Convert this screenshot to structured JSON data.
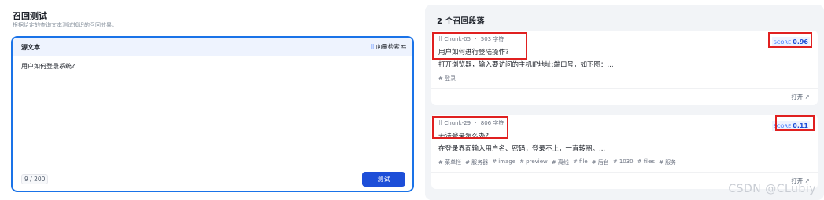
{
  "left": {
    "title": "召回测试",
    "desc": "根据给定的查询文本测试知识的召回效果。",
    "source": {
      "label": "源文本",
      "mode_label": "向量检索",
      "mode_icon": "grid-icon",
      "switch_icon": "swap-icon",
      "text": "用户如何登录系统?",
      "counter": "9 / 200",
      "test_button": "测试"
    }
  },
  "results": {
    "title": "2 个召回段落",
    "items": [
      {
        "chunk": "Chunk-05",
        "chars": "503 字符",
        "question": "用户如何进行登陆操作?",
        "answer": "打开浏览器，输入要访问的主机IP地址:端口号，如下图：...",
        "tags": [
          "# 登录"
        ],
        "score_label": "SCORE",
        "score": "0.96",
        "open": "打开"
      },
      {
        "chunk": "Chunk-29",
        "chars": "806 字符",
        "question": "无法登录怎么办?",
        "answer": "在登录界面输入用户名、密码，登录不上，一直转圈。...",
        "tags": [
          "# 菜单栏",
          "# 服务器",
          "# image",
          "# preview",
          "# 离线",
          "# file",
          "# 后台",
          "# 1030",
          "# files",
          "# 服务"
        ],
        "score_label": "SCORE",
        "score": "0.11",
        "open": "打开"
      }
    ]
  },
  "watermark": "CSDN @CLubiy",
  "colors": {
    "accent": "#1a73e8",
    "button": "#1d4ed8",
    "highlight": "#e02020"
  }
}
